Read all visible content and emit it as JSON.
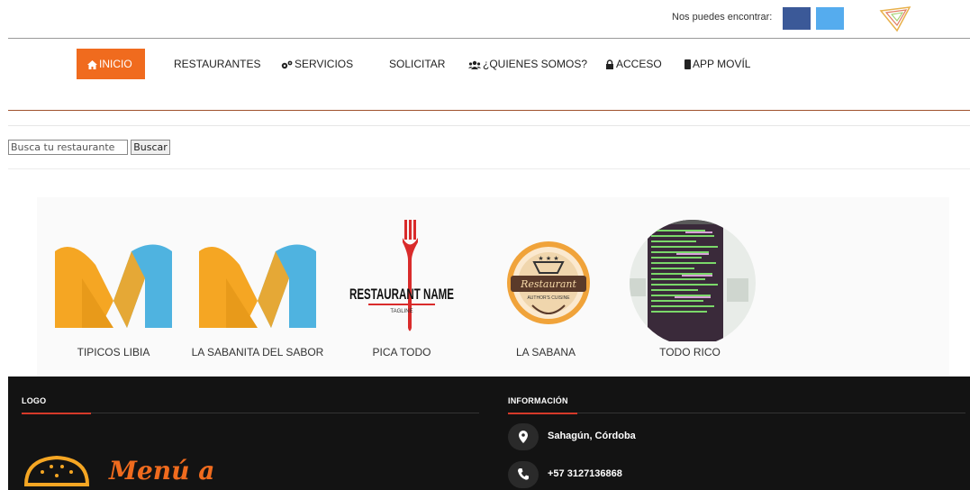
{
  "topbar": {
    "find_label": "Nos puedes encontrar:"
  },
  "nav": {
    "items": [
      {
        "label": "INICIO",
        "icon": "home-icon"
      },
      {
        "label": "RESTAURANTES"
      },
      {
        "label": "SERVICIOS",
        "icon": "gears-icon"
      },
      {
        "label": "SOLICITAR"
      },
      {
        "label": "¿QUIENES SOMOS?",
        "icon": "users-icon"
      },
      {
        "label": "ACCESO",
        "icon": "lock-icon"
      },
      {
        "label": "APP MOVÍL",
        "icon": "mobile-icon"
      }
    ]
  },
  "search": {
    "placeholder": "Busca tu restaurante",
    "button_label": "Buscar"
  },
  "restaurants": [
    {
      "name": "TIPICOS LIBIA"
    },
    {
      "name": "LA SABANITA DEL SABOR"
    },
    {
      "name": "PICA TODO",
      "logo_text": "RESTAURANT NAME",
      "logo_sub": "TAGLINE"
    },
    {
      "name": "LA SABANA",
      "logo_text": "Restaurant",
      "logo_sub": "AUTHOR'S CUISINE"
    },
    {
      "name": "TODO RICO"
    }
  ],
  "footer": {
    "logo_heading": "LOGO",
    "info_heading": "INFORMACIÓN",
    "location": "Sahagún, Córdoba",
    "phone": "+57 3127136868",
    "brand_text": "Menú a"
  },
  "colors": {
    "accent": "#f06b1e",
    "footer_bg": "#131313",
    "facebook": "#3b5998",
    "twitter": "#55acee"
  }
}
